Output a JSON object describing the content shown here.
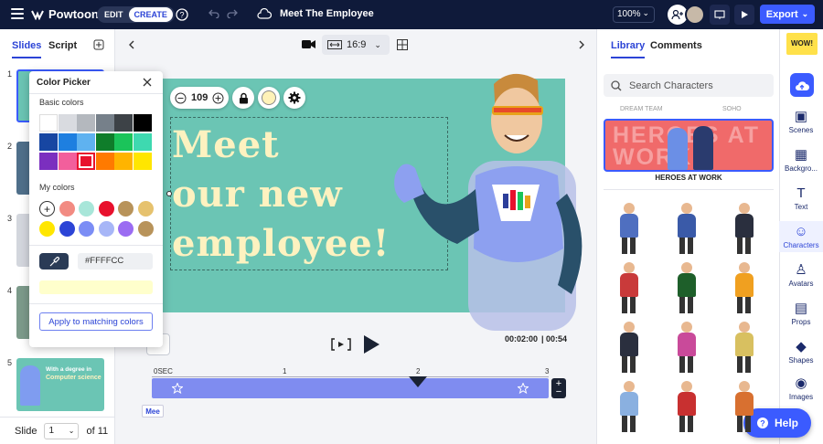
{
  "app": {
    "brand": "Powtoon",
    "title": "Meet The Employee",
    "mode_edit": "EDIT",
    "mode_create": "CREATE",
    "zoom": "100%",
    "export": "Export"
  },
  "left_panel": {
    "tab_slides": "Slides",
    "tab_script": "Script",
    "slide_numbers": [
      "1",
      "2",
      "3",
      "4",
      "5"
    ],
    "slide5_line1": "With a degree in",
    "slide5_line2": "Computer science",
    "slide_label": "Slide",
    "slide_current": "1",
    "slide_total": "of 11"
  },
  "color_picker": {
    "title": "Color Picker",
    "basic_label": "Basic colors",
    "basic_colors": [
      "#ffffff",
      "#d9dbe0",
      "#b4b8be",
      "#76808a",
      "#3d4247",
      "#000000",
      "#1746a2",
      "#1e7fe0",
      "#5fb2f0",
      "#0f7d2a",
      "#1bc45a",
      "#3ed9b0",
      "#7b2fbf",
      "#f25f9c",
      "#e8112d",
      "#ff7a00",
      "#ffb400",
      "#ffe600"
    ],
    "my_label": "My colors",
    "my_colors": [
      "#f28b82",
      "#a8e6d9",
      "#e8112d",
      "#b8935a",
      "#e6c26e",
      "#ffe600",
      "#2c44d6",
      "#7b8df5",
      "#a7b6f7",
      "#9b6cf2",
      "#b8935a"
    ],
    "hex_value": "#FFFFCC",
    "preview_color": "#ffffcc",
    "apply_label": "Apply to matching colors"
  },
  "canvas": {
    "font_size": "109",
    "headline": [
      "Meet",
      "our new",
      "employee!"
    ],
    "aspect": "16:9",
    "time_current": "00:02:00",
    "time_total": "00:54",
    "tick_labels": [
      "0SEC",
      "1",
      "2",
      "3"
    ],
    "element_label": "Mee"
  },
  "right_panel": {
    "tab_library": "Library",
    "tab_comments": "Comments",
    "search_placeholder": "Search Characters",
    "category_small_left": "DREAM TEAM",
    "category_small_right": "SOHO",
    "category_title": "HEROES AT WORK",
    "banner_text": "HEROES AT WORK"
  },
  "rail": {
    "items": [
      "Scenes",
      "Backgro...",
      "Text",
      "Characters",
      "Avatars",
      "Props",
      "Shapes",
      "Images"
    ]
  },
  "help": "Help",
  "colors": {
    "accent": "#3b5bff",
    "stage": "#6bc5b4",
    "headline": "#fdf2c0",
    "topbar": "#0f1a3a"
  }
}
